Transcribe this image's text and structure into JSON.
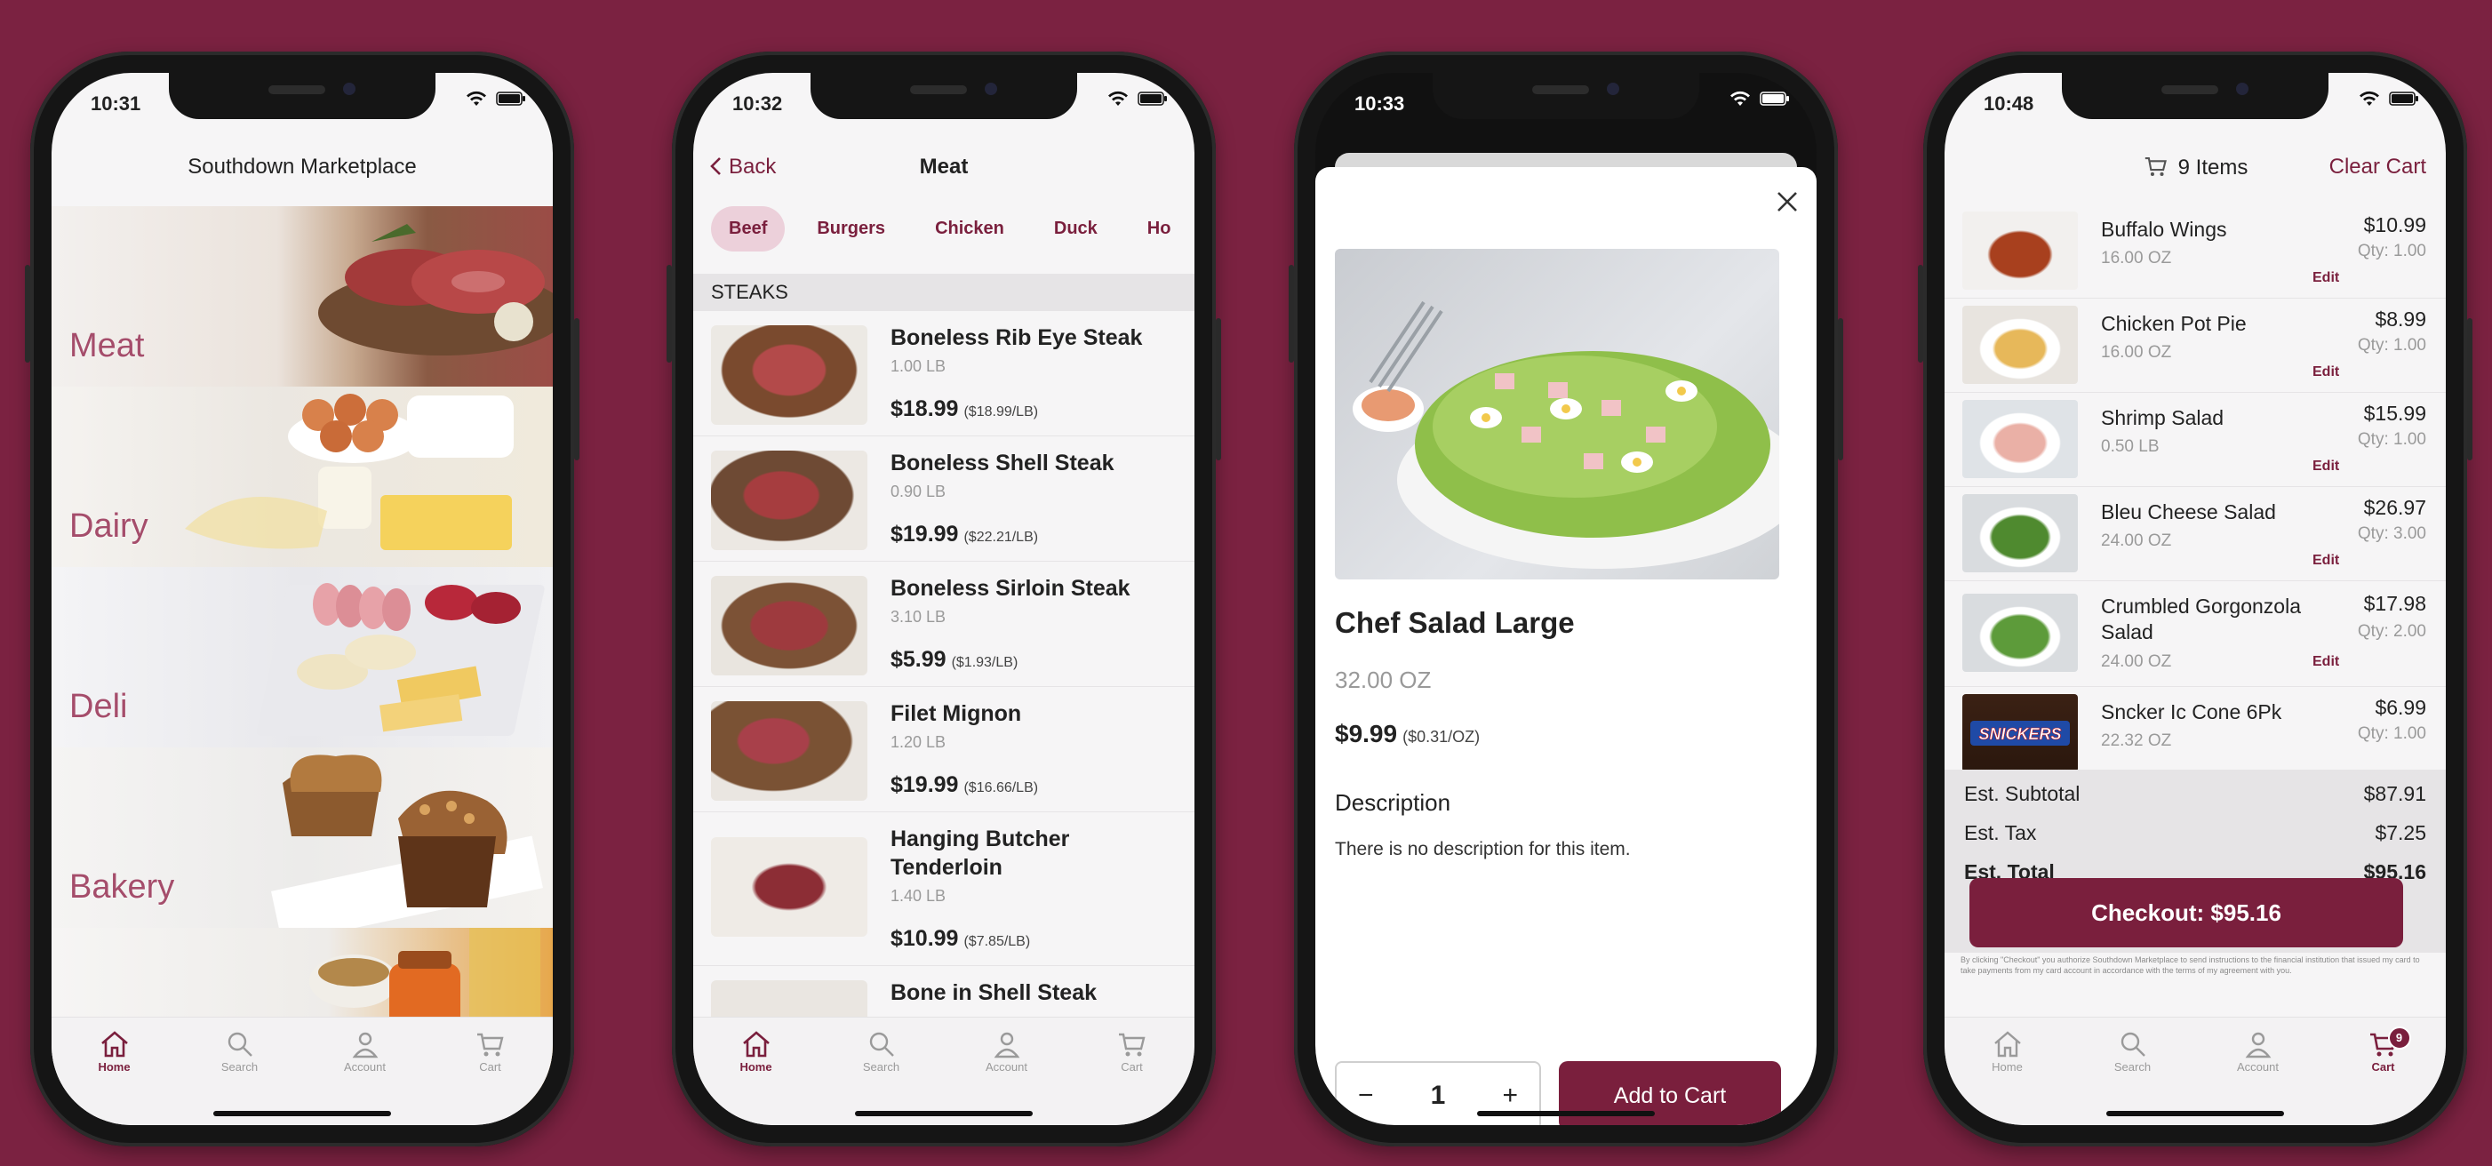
{
  "colors": {
    "brand": "#7a1f3d",
    "background": "#7b2241",
    "category_label": "#a54d6b"
  },
  "phones": {
    "home": {
      "time": "10:31",
      "title": "Southdown Marketplace",
      "categories": [
        {
          "label": "Meat"
        },
        {
          "label": "Dairy"
        },
        {
          "label": "Deli"
        },
        {
          "label": "Bakery"
        },
        {
          "label": ""
        }
      ]
    },
    "meat": {
      "time": "10:32",
      "back_label": "Back",
      "title": "Meat",
      "chips": [
        "Beef",
        "Burgers",
        "Chicken",
        "Duck",
        "Ho"
      ],
      "active_chip": "Beef",
      "section": "STEAKS",
      "products": [
        {
          "name": "Boneless Rib Eye Steak",
          "weight": "1.00 LB",
          "price": "$18.99",
          "unit": "($18.99/LB)"
        },
        {
          "name": "Boneless Shell Steak",
          "weight": "0.90 LB",
          "price": "$19.99",
          "unit": "($22.21/LB)"
        },
        {
          "name": "Boneless Sirloin Steak",
          "weight": "3.10 LB",
          "price": "$5.99",
          "unit": "($1.93/LB)"
        },
        {
          "name": "Filet Mignon",
          "weight": "1.20 LB",
          "price": "$19.99",
          "unit": "($16.66/LB)"
        },
        {
          "name": "Hanging Butcher Tenderloin",
          "weight": "1.40 LB",
          "price": "$10.99",
          "unit": "($7.85/LB)"
        },
        {
          "name": "Bone in Shell Steak",
          "weight": "",
          "price": "",
          "unit": ""
        }
      ]
    },
    "detail": {
      "time": "10:33",
      "name": "Chef Salad Large",
      "weight": "32.00 OZ",
      "price": "$9.99",
      "unit": "($0.31/OZ)",
      "description_heading": "Description",
      "description": "There is no description for this item.",
      "quantity": "1",
      "minus": "−",
      "plus": "+",
      "add_label": "Add to Cart"
    },
    "cart": {
      "time": "10:48",
      "items_label": "9 Items",
      "clear_label": "Clear Cart",
      "items": [
        {
          "name": "Buffalo Wings",
          "weight": "16.00 OZ",
          "price": "$10.99",
          "qty": "Qty: 1.00",
          "edit": "Edit"
        },
        {
          "name": "Chicken Pot Pie",
          "weight": "16.00 OZ",
          "price": "$8.99",
          "qty": "Qty: 1.00",
          "edit": "Edit"
        },
        {
          "name": "Shrimp Salad",
          "weight": "0.50 LB",
          "price": "$15.99",
          "qty": "Qty: 1.00",
          "edit": "Edit"
        },
        {
          "name": "Bleu Cheese Salad",
          "weight": "24.00 OZ",
          "price": "$26.97",
          "qty": "Qty: 3.00",
          "edit": "Edit"
        },
        {
          "name": "Crumbled Gorgonzola Salad",
          "weight": "24.00 OZ",
          "price": "$17.98",
          "qty": "Qty: 2.00",
          "edit": "Edit"
        },
        {
          "name": "Sncker Ic Cone 6Pk",
          "weight": "22.32 OZ",
          "price": "$6.99",
          "qty": "Qty: 1.00",
          "edit": ""
        }
      ],
      "subtotal_label": "Est. Subtotal",
      "subtotal": "$87.91",
      "tax_label": "Est. Tax",
      "tax": "$7.25",
      "total_label": "Est. Total",
      "total": "$95.16",
      "checkout_label": "Checkout:  $95.16",
      "legal": "By clicking \"Checkout\" you authorize Southdown Marketplace to send instructions to the financial institution that issued my card to take payments from my card account in accordance with the terms of my agreement with you.",
      "badge": "9"
    }
  },
  "tabbar": {
    "home": "Home",
    "search": "Search",
    "account": "Account",
    "cart": "Cart"
  }
}
